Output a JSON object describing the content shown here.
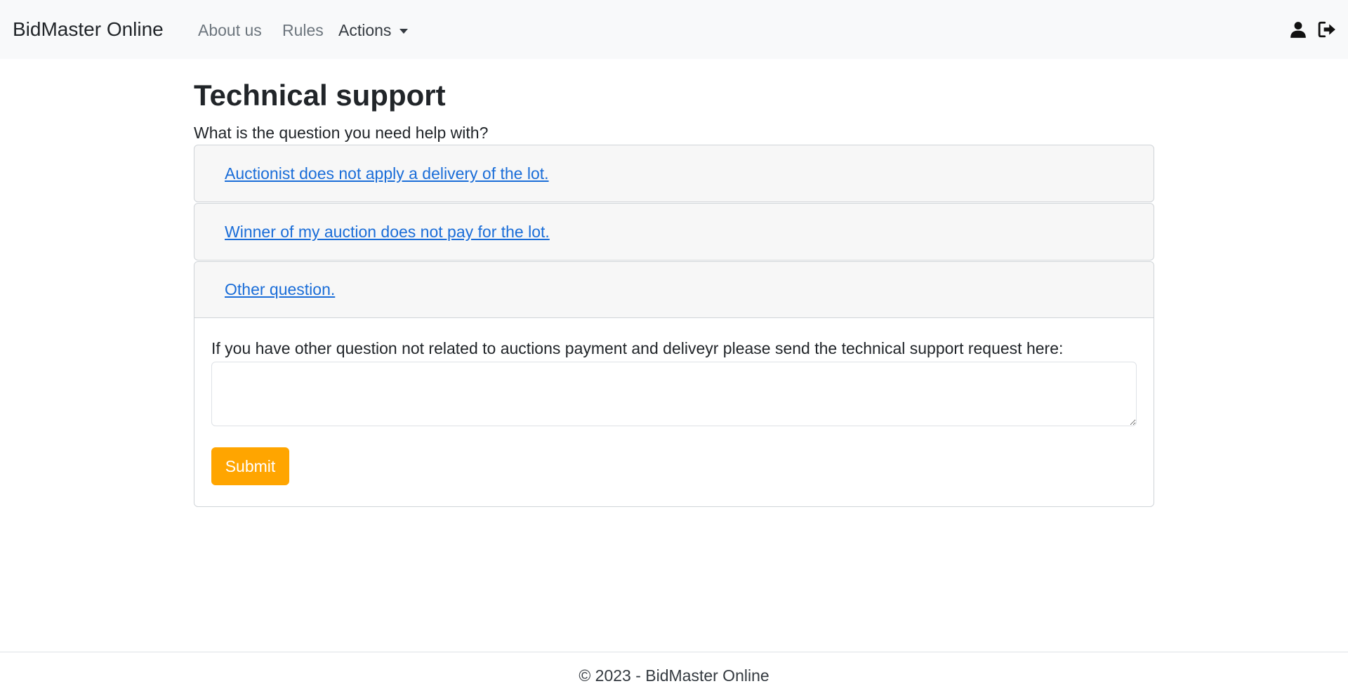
{
  "navbar": {
    "brand": "BidMaster Online",
    "links": {
      "about": "About us",
      "rules": "Rules",
      "actions": "Actions"
    },
    "icons": [
      "user-icon",
      "logout-icon"
    ]
  },
  "main": {
    "title": "Technical support",
    "prompt": "What is the question you need help with?",
    "accordion": [
      {
        "label": "Auctionist does not apply a delivery of the lot."
      },
      {
        "label": "Winner of my auction does not pay for the lot."
      },
      {
        "label": "Other question."
      }
    ],
    "other_question": {
      "text": "If you have other question not related to auctions payment and deliveyr please send the technical support request here:",
      "textarea_value": "",
      "submit_label": "Submit"
    }
  },
  "footer": {
    "text": "© 2023 - BidMaster Online"
  },
  "colors": {
    "navbar_bg": "#f8f9fa",
    "link": "#1a6dd8",
    "submit_bg": "#ffa500"
  }
}
